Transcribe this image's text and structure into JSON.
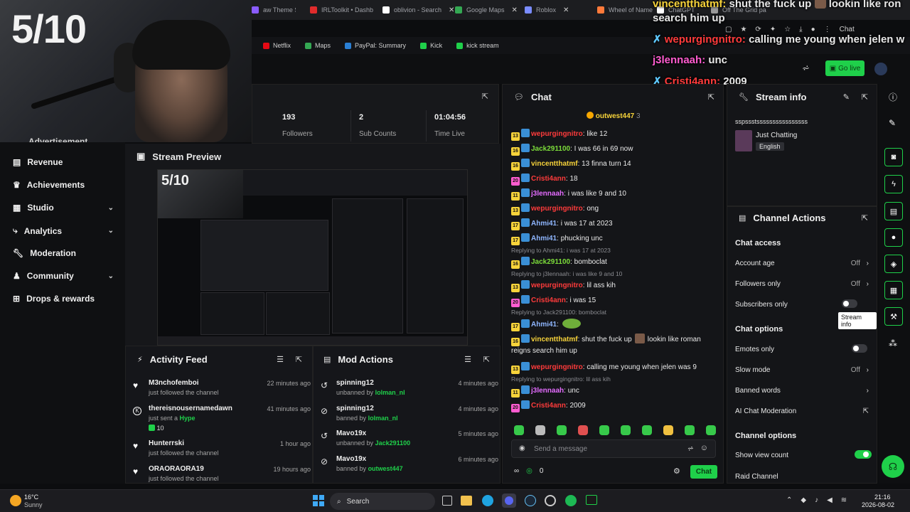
{
  "webcam": {
    "score": "5/10"
  },
  "browser": {
    "tabs": [
      {
        "label": "aw Theme Song",
        "color": "#8a5cff"
      },
      {
        "label": "IRLToolkit • Dashb",
        "color": "#e02b2b"
      },
      {
        "label": "oblivion - Search",
        "color": "#ffffff"
      },
      {
        "label": "Google Maps",
        "color": "#34a853"
      },
      {
        "label": "Roblox",
        "color": "#7a8cff"
      },
      {
        "label": "Wheel of Name",
        "color": "#ff7a3a"
      },
      {
        "label": "ChatGPT",
        "color": "#ffffff"
      },
      {
        "label": "Off The Grid pa",
        "color": "#999999"
      }
    ],
    "bookmarks": [
      "Netflix",
      "Maps",
      "PayPal: Summary",
      "Kick",
      "kick stream"
    ],
    "chatgpt_btn": "Chat"
  },
  "overlay": {
    "lines": [
      {
        "user": "vincentthatmf:",
        "text": "shut the fuck up",
        "extra": "lookin like ron",
        "color": "#f7d33a"
      },
      {
        "text": "search him up"
      },
      {
        "user": "wepurgingnitro:",
        "text": "calling me young when jelen w",
        "color": "#ff3b3b"
      },
      {
        "user": "j3lennaah:",
        "text": "unc",
        "color": "#ff5cd0"
      },
      {
        "user": "Cristi4ann:",
        "text": "2009",
        "color": "#ff3b3b"
      }
    ]
  },
  "header": {
    "go_live": "Go live"
  },
  "nav": {
    "partial": "Advertisement",
    "items": [
      {
        "label": "Revenue",
        "icon": "revenue-icon",
        "expand": false
      },
      {
        "label": "Achievements",
        "icon": "trophy-icon",
        "expand": false
      },
      {
        "label": "Studio",
        "icon": "studio-icon",
        "expand": true
      },
      {
        "label": "Analytics",
        "icon": "analytics-icon",
        "expand": true
      },
      {
        "label": "Moderation",
        "icon": "wrench-icon",
        "expand": false
      },
      {
        "label": "Community",
        "icon": "community-icon",
        "expand": true
      },
      {
        "label": "Drops & rewards",
        "icon": "gift-icon",
        "expand": false
      }
    ]
  },
  "stats": [
    {
      "value": "193",
      "label": "Followers"
    },
    {
      "value": "2",
      "label": "Sub Counts"
    },
    {
      "value": "01:04:56",
      "label": "Time Live"
    }
  ],
  "preview": {
    "title": "Stream Preview",
    "score": "5/10"
  },
  "activity": {
    "title": "Activity Feed",
    "items": [
      {
        "name": "M3nchofemboi",
        "sub": "just followed the channel",
        "time": "22 minutes ago",
        "icon": "heart-icon"
      },
      {
        "name": "thereisnousernamedawn",
        "sub": "just sent a",
        "sub_highlight": "Hype",
        "amount": "10",
        "time": "41 minutes ago",
        "icon": "kick-icon"
      },
      {
        "name": "Hunterrski",
        "sub": "just followed the channel",
        "time": "1 hour ago",
        "icon": "heart-icon"
      },
      {
        "name": "ORAORAORA19",
        "sub": "just followed the channel",
        "time": "19 hours ago",
        "icon": "heart-icon"
      }
    ]
  },
  "modactions": {
    "title": "Mod Actions",
    "items": [
      {
        "name": "spinning12",
        "action": "unbanned by",
        "by": "lolman_nl",
        "time": "4 minutes ago",
        "icon": "unban-icon"
      },
      {
        "name": "spinning12",
        "action": "banned by",
        "by": "lolman_nl",
        "time": "4 minutes ago",
        "icon": "ban-icon"
      },
      {
        "name": "Mavo19x",
        "action": "unbanned by",
        "by": "Jack291100",
        "time": "5 minutes ago",
        "icon": "unban-icon"
      },
      {
        "name": "Mavo19x",
        "action": "banned by",
        "by": "outwest447",
        "time": "6 minutes ago",
        "icon": "ban-icon"
      }
    ]
  },
  "chat": {
    "title": "Chat",
    "pinned_user": "outwest447",
    "pinned_count": "3",
    "messages": [
      {
        "badge": "13",
        "user": "wepurgingnitro",
        "text": "like 12",
        "color": "red"
      },
      {
        "badge": "16",
        "user": "Jack291100",
        "text": "I was 66 in 69 now",
        "color": "green"
      },
      {
        "badge": "16",
        "user": "vincentthatmf",
        "text": "13 finna turn 14",
        "color": "yellow"
      },
      {
        "badge": "20",
        "user": "Cristi4ann",
        "text": "18",
        "color": "red"
      },
      {
        "badge": "11",
        "user": "j3lennaah",
        "text": "i was like 9 and 10",
        "color": "purple"
      },
      {
        "badge": "13",
        "user": "wepurgingnitro",
        "text": "ong",
        "color": "red"
      },
      {
        "badge": "17",
        "user": "Ahmi41",
        "text": "i was 17 at 2023",
        "color": "blue"
      },
      {
        "badge": "17",
        "user": "Ahmi41",
        "text": "phucking unc",
        "color": "blue"
      },
      {
        "reply": "Replying to Ahmi41: i was 17 at 2023",
        "badge": "16",
        "user": "Jack291100",
        "text": "bomboclat",
        "color": "green"
      },
      {
        "reply": "Replying to j3lennaah: i was like 9 and 10",
        "badge": "13",
        "user": "wepurgingnitro",
        "text": "lil ass kih",
        "color": "red"
      },
      {
        "badge": "20",
        "user": "Cristi4ann",
        "text": "i was 15",
        "color": "red"
      },
      {
        "reply": "Replying to Jack291100: bomboclat",
        "badge": "17",
        "user": "Ahmi41",
        "text": "",
        "color": "blue"
      },
      {
        "badge": "16",
        "user": "vincentthatmf",
        "text": "shut the fuck up",
        "text2": "lookin like roman",
        "text3": "reigns search him up",
        "color": "yellow"
      },
      {
        "badge": "13",
        "user": "wepurgingnitro",
        "text": "calling me young when jelen was 9",
        "color": "red"
      },
      {
        "reply": "Replying to wepurgingnitro: lil ass kih",
        "badge": "11",
        "user": "j3lennaah",
        "text": "unc",
        "color": "purple"
      },
      {
        "badge": "20",
        "user": "Cristi4ann",
        "text": "2009",
        "color": "red"
      }
    ],
    "input_placeholder": "Send a message",
    "footer_count": "0",
    "send_label": "Chat"
  },
  "stream_info": {
    "title": "Stream info",
    "stream_title": "sspssstssssssssssssssss",
    "category": "Just Chatting",
    "language": "English"
  },
  "channel_actions": {
    "title": "Channel Actions",
    "chat_access": "Chat access",
    "account_age": {
      "label": "Account age",
      "value": "Off"
    },
    "followers_only": {
      "label": "Followers only",
      "value": "Off"
    },
    "subscribers_only": {
      "label": "Subscribers only"
    },
    "tooltip": "Stream info",
    "chat_options": "Chat options",
    "emotes_only": {
      "label": "Emotes only"
    },
    "slow_mode": {
      "label": "Slow mode",
      "value": "Off"
    },
    "banned_words": {
      "label": "Banned words"
    },
    "ai_moderation": {
      "label": "AI Chat Moderation"
    },
    "channel_options": "Channel options",
    "show_view_count": {
      "label": "Show view count"
    },
    "raid_channel": {
      "label": "Raid Channel"
    }
  },
  "taskbar": {
    "weather_temp": "16°C",
    "weather_desc": "Sunny",
    "search": "Search",
    "time": "21:16",
    "date": "2026-08-02"
  },
  "colors": {
    "accent": "#1fd04a",
    "panel": "#141518",
    "bg": "#0c0d0f"
  }
}
